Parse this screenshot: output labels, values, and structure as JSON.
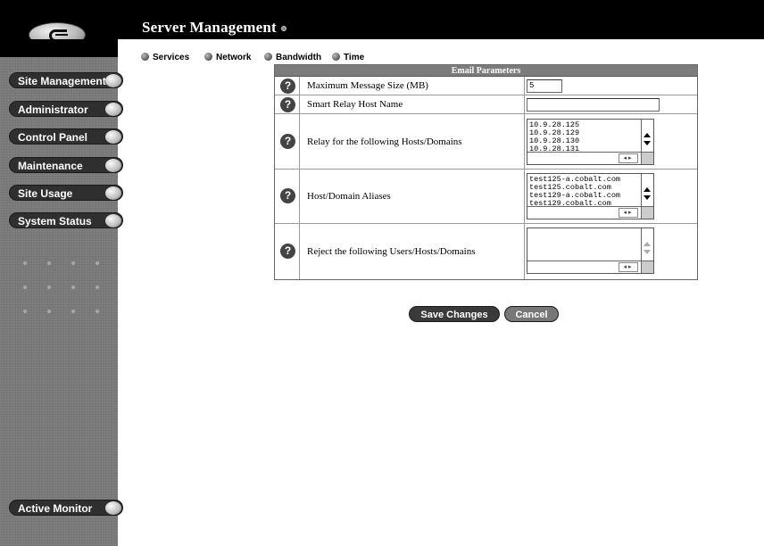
{
  "header": {
    "title": "Server Management"
  },
  "sidebar": {
    "items": [
      {
        "label": "Site Management"
      },
      {
        "label": "Administrator"
      },
      {
        "label": "Control Panel"
      },
      {
        "label": "Maintenance"
      },
      {
        "label": "Site Usage"
      },
      {
        "label": "System Status"
      },
      {
        "label": "Active Monitor"
      }
    ]
  },
  "tabs": [
    {
      "label": "Services"
    },
    {
      "label": "Network"
    },
    {
      "label": "Bandwidth"
    },
    {
      "label": "Time"
    }
  ],
  "email_params": {
    "header": "Email Parameters",
    "help_glyph": "?",
    "rows": [
      {
        "label": "Maximum Message Size (MB)",
        "value": "5"
      },
      {
        "label": "Smart Relay Host Name",
        "value": ""
      },
      {
        "label": "Relay for the following Hosts/Domains",
        "value": "10.9.28.125\n10.9.28.129\n10.9.28.130\n10.9.28.131"
      },
      {
        "label": "Host/Domain Aliases",
        "value": "test125-a.cobalt.com\ntest125.cobalt.com\ntest129-a.cobalt.com\ntest129.cobalt.com"
      },
      {
        "label": "Reject the following Users/Hosts/Domains",
        "value": ""
      }
    ]
  },
  "buttons": {
    "save": "Save Changes",
    "cancel": "Cancel"
  },
  "colors": {
    "header_bg": "#000000",
    "sidebar_bg": "#7a7a7a",
    "button_bg": "#2f2f2f"
  }
}
